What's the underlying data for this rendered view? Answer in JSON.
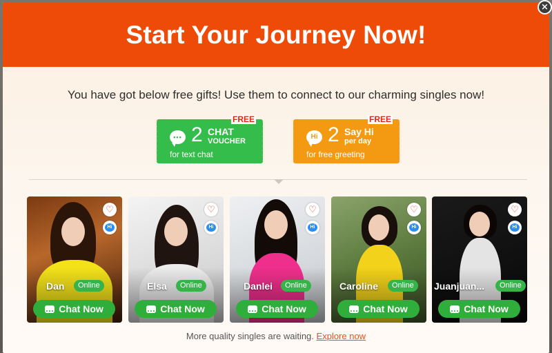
{
  "header": {
    "title": "Start Your Journey Now!"
  },
  "close": {
    "glyph": "×"
  },
  "intro": {
    "text": "You have got below free gifts! Use them to connect to our charming singles now!"
  },
  "vouchers": [
    {
      "badge": "FREE",
      "icon": "chat-bubble-icon",
      "count": "2",
      "title": "CHAT",
      "subtitle": "VOUCHER",
      "desc": "for text chat",
      "color": "#35bd4b"
    },
    {
      "badge": "FREE",
      "icon": "hi-bubble-icon",
      "icon_text": "Hi",
      "count": "2",
      "title": "Say Hi",
      "subtitle": "per day",
      "desc": "for free greeting",
      "color": "#f39a12"
    }
  ],
  "profiles": [
    {
      "name": "Dan",
      "status": "Online",
      "button": "Chat Now"
    },
    {
      "name": "Elsa",
      "status": "Online",
      "button": "Chat Now"
    },
    {
      "name": "Danlei",
      "status": "Online",
      "button": "Chat Now"
    },
    {
      "name": "Caroline",
      "status": "Online",
      "button": "Chat Now"
    },
    {
      "name": "Juanjuan...",
      "status": "Online",
      "button": "Chat Now"
    }
  ],
  "hi_icon_text": "Hi",
  "footer": {
    "text": "More quality singles are waiting.",
    "link": "Explore now"
  },
  "colors": {
    "header": "#ee4a08",
    "online": "#36b44a",
    "chat_button": "#2fae3c",
    "link": "#e8521c"
  }
}
